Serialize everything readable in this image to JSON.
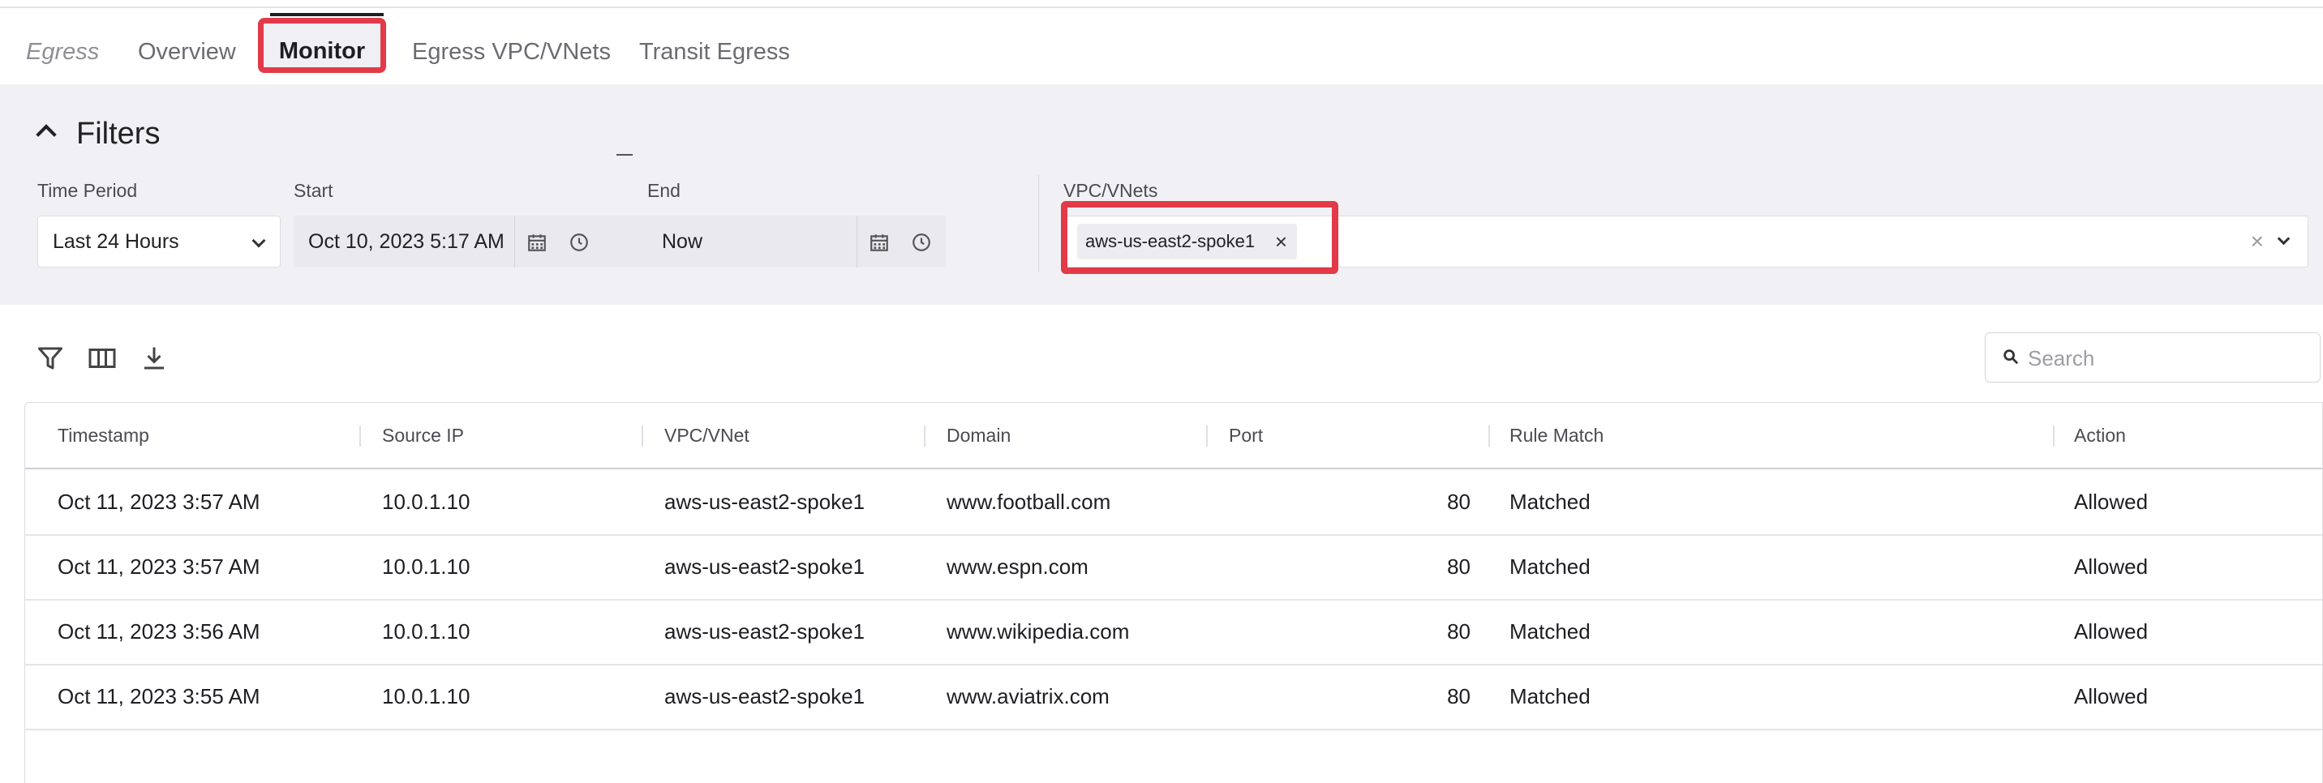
{
  "tabs": {
    "section": "Egress",
    "items": [
      "Overview",
      "Monitor",
      "Egress VPC/VNets",
      "Transit Egress"
    ],
    "active": "Monitor"
  },
  "filters": {
    "title": "Filters",
    "time_period": {
      "label": "Time Period",
      "value": "Last 24 Hours"
    },
    "start": {
      "label": "Start",
      "value": "Oct 10, 2023 5:17 AM"
    },
    "end": {
      "label": "End",
      "value": "Now"
    },
    "vpc": {
      "label": "VPC/VNets",
      "chips": [
        "aws-us-east2-spoke1"
      ]
    }
  },
  "toolbar": {
    "icons": [
      "filter-icon",
      "columns-icon",
      "download-icon"
    ],
    "search_placeholder": "Search"
  },
  "table": {
    "columns": [
      "Timestamp",
      "Source IP",
      "VPC/VNet",
      "Domain",
      "Port",
      "Rule Match",
      "Action"
    ],
    "rows": [
      [
        "Oct 11, 2023 3:57 AM",
        "10.0.1.10",
        "aws-us-east2-spoke1",
        "www.football.com",
        "80",
        "Matched",
        "Allowed"
      ],
      [
        "Oct 11, 2023 3:57 AM",
        "10.0.1.10",
        "aws-us-east2-spoke1",
        "www.espn.com",
        "80",
        "Matched",
        "Allowed"
      ],
      [
        "Oct 11, 2023 3:56 AM",
        "10.0.1.10",
        "aws-us-east2-spoke1",
        "www.wikipedia.com",
        "80",
        "Matched",
        "Allowed"
      ],
      [
        "Oct 11, 2023 3:55 AM",
        "10.0.1.10",
        "aws-us-east2-spoke1",
        "www.aviatrix.com",
        "80",
        "Matched",
        "Allowed"
      ]
    ]
  },
  "colors": {
    "highlight": "#e23a48",
    "panel_bg": "#f1f1f5"
  }
}
